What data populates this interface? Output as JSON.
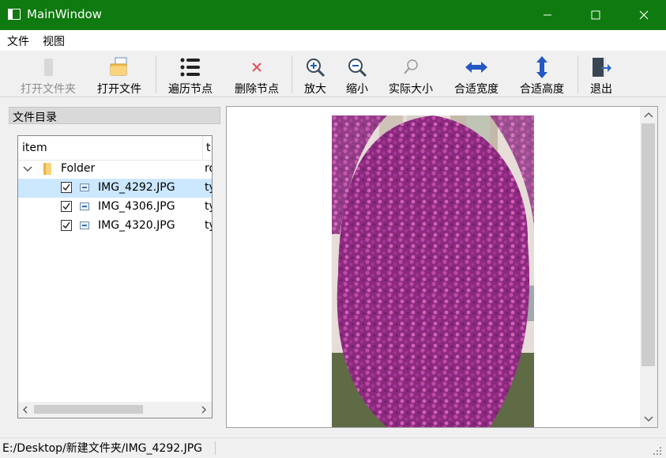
{
  "window": {
    "title": "MainWindow"
  },
  "menu": {
    "items": [
      "文件",
      "视图"
    ]
  },
  "toolbar": {
    "open_folder": "打开文件夹",
    "open_file": "打开文件",
    "traverse_nodes": "遍历节点",
    "delete_node": "删除节点",
    "zoom_in": "放大",
    "zoom_out": "缩小",
    "actual_size": "实际大小",
    "fit_width": "合适宽度",
    "fit_height": "合适高度",
    "exit": "退出"
  },
  "dock": {
    "title": "文件目录",
    "columns": [
      "item",
      "t"
    ],
    "folder": {
      "name": "Folder",
      "col2": "ro"
    },
    "files": [
      {
        "name": "IMG_4292.JPG",
        "col2": "ty",
        "checked": true,
        "selected": true
      },
      {
        "name": "IMG_4306.JPG",
        "col2": "ty",
        "checked": true,
        "selected": false
      },
      {
        "name": "IMG_4320.JPG",
        "col2": "ty",
        "checked": true,
        "selected": false
      }
    ]
  },
  "status": {
    "path": "E:/Desktop/新建文件夹/IMG_4292.JPG"
  },
  "colors": {
    "titlebar": "#0f7a0f",
    "selection": "#cce8ff",
    "blossom": "#a0308a"
  },
  "icons": [
    "window-icon",
    "minimize-icon",
    "maximize-icon",
    "close-icon",
    "open-folder-icon",
    "open-file-icon",
    "list-icon",
    "delete-icon",
    "zoom-in-icon",
    "zoom-out-icon",
    "search-icon",
    "arrow-horizontal-icon",
    "arrow-vertical-icon",
    "exit-icon"
  ]
}
